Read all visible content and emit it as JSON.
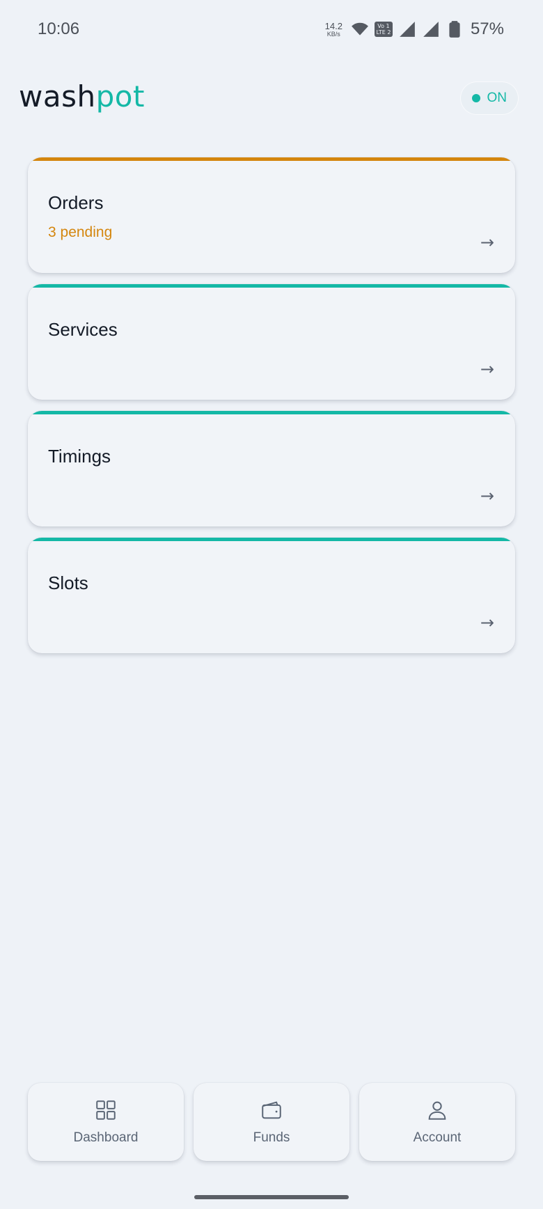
{
  "status_bar": {
    "time": "10:06",
    "net_speed_value": "14.2",
    "net_speed_unit": "KB/s",
    "volte_top": "Vo 1",
    "volte_bottom": "LTE 2",
    "battery": "57%"
  },
  "header": {
    "logo_part1": "wash",
    "logo_part2": "pot",
    "status_toggle_label": "ON"
  },
  "cards": [
    {
      "title": "Orders",
      "subtitle": "3 pending",
      "arrow": "→",
      "accent": "#D4860E"
    },
    {
      "title": "Services",
      "subtitle": "",
      "arrow": "→",
      "accent": "#14B8A6"
    },
    {
      "title": "Timings",
      "subtitle": "",
      "arrow": "→",
      "accent": "#14B8A6"
    },
    {
      "title": "Slots",
      "subtitle": "",
      "arrow": "→",
      "accent": "#14B8A6"
    }
  ],
  "bottom_nav": [
    {
      "label": "Dashboard",
      "icon": "dashboard-icon"
    },
    {
      "label": "Funds",
      "icon": "wallet-icon"
    },
    {
      "label": "Account",
      "icon": "user-icon"
    }
  ],
  "colors": {
    "brand": "#14B8A6",
    "pending": "#D4860E",
    "background": "#EEF2F7"
  }
}
